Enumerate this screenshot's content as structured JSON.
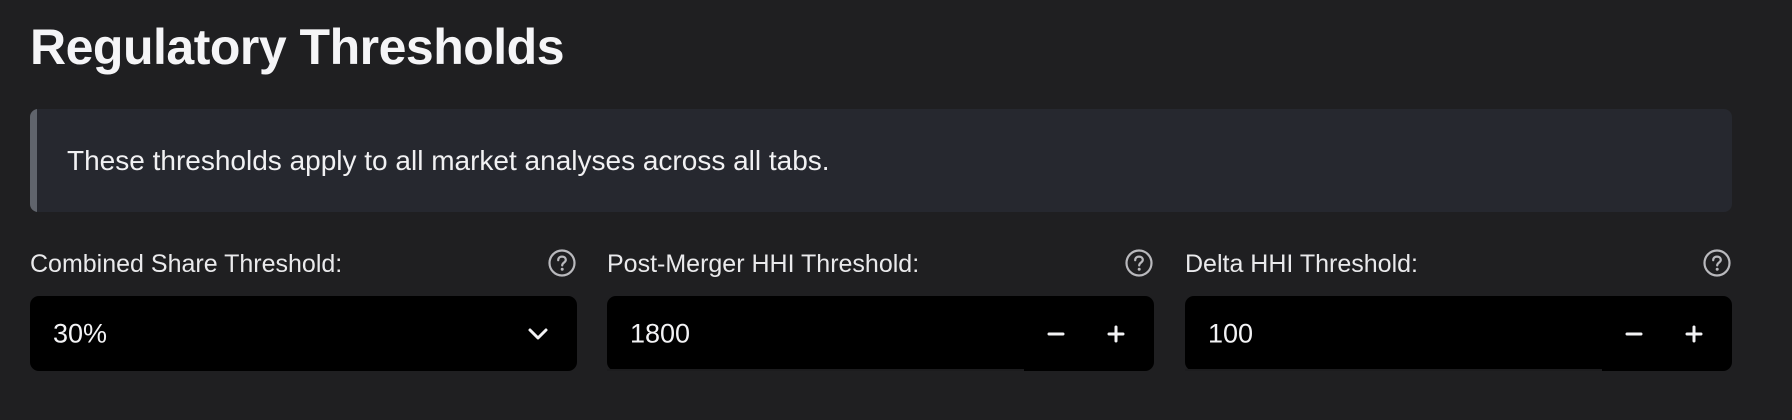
{
  "header": {
    "title": "Regulatory Thresholds"
  },
  "info": {
    "message": "These thresholds apply to all market analyses across all tabs."
  },
  "fields": {
    "combined_share": {
      "label": "Combined Share Threshold:",
      "value": "30%",
      "type": "select",
      "icon": "chevron-down-icon"
    },
    "post_merger_hhi": {
      "label": "Post-Merger HHI Threshold:",
      "value": "1800",
      "type": "number",
      "decrement_icon": "minus-icon",
      "increment_icon": "plus-icon"
    },
    "delta_hhi": {
      "label": "Delta HHI Threshold:",
      "value": "100",
      "type": "number",
      "decrement_icon": "minus-icon",
      "increment_icon": "plus-icon"
    }
  },
  "help_icon": "help-circle-icon",
  "colors": {
    "background": "#1f1f21",
    "info_bg": "#26282f",
    "info_accent": "#60646c",
    "input_bg": "#000000",
    "text": "#fafafa"
  }
}
